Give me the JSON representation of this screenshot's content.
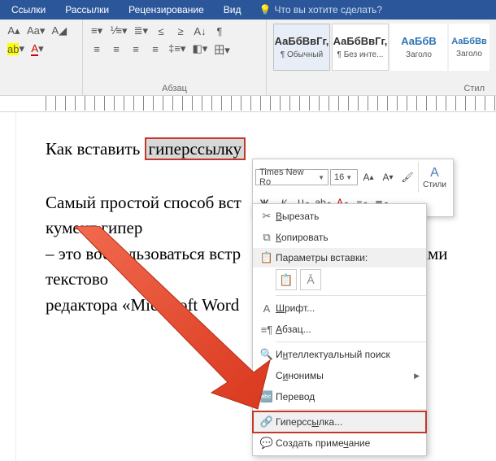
{
  "tabs": {
    "items": [
      "Ссылки",
      "Рассылки",
      "Рецензирование",
      "Вид"
    ],
    "tell_me": "Что вы хотите сделать?"
  },
  "ribbon": {
    "paragraph_label": "Абзац",
    "styles_label": "Стил",
    "style_sample": "АаБбВвГг,",
    "style_sample_en": "АаБбВ",
    "style_sample_en2": "АаБбВв",
    "style1": "¶ Обычный",
    "style2": "¶ Без инте...",
    "style3": "Заголо",
    "style4": "Заголо"
  },
  "document": {
    "line1a": "Как вставить ",
    "line1b": "гиперссылку",
    "line2a": "Самый простой способ вст",
    "line2b": "кумент гипер",
    "line3a": "– это воспользоваться встр",
    "line3b": "ами текстово",
    "line4": "редактора «Microsoft Word"
  },
  "mini_toolbar": {
    "font": "Times New Ro",
    "size": "16",
    "styles_label": "Стили"
  },
  "context_menu": {
    "cut": "Вырезать",
    "copy": "Копировать",
    "paste_header": "Параметры вставки:",
    "font": "Шрифт...",
    "paragraph": "Абзац...",
    "smart": "Интеллектуальный поиск",
    "synonyms": "Синонимы",
    "translate": "Перевод",
    "hyperlink": "Гиперссылка...",
    "comment": "Создать примечание"
  }
}
